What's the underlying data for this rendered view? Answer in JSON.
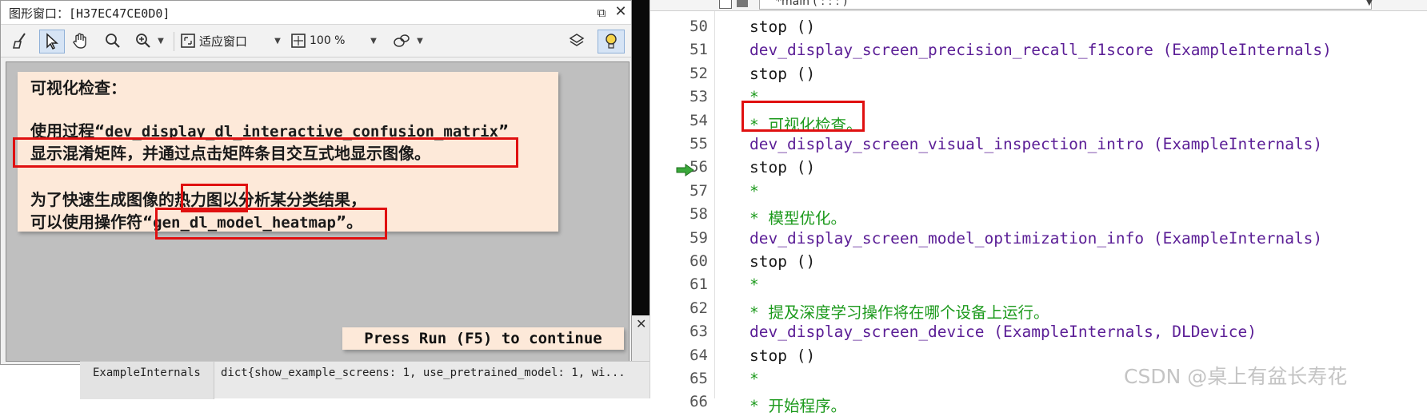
{
  "graphics_window": {
    "title": "图形窗口：[H37EC47CE0D0]",
    "toolbar": {
      "fit_label": "适应窗口",
      "zoom_label": "100 %"
    },
    "message": {
      "heading": "可视化检查：",
      "line1_a": "使用过程“",
      "line1_code": "dev_display_dl_interactive_confusion_matrix",
      "line1_b": "”",
      "line2": "显示混淆矩阵，并通过点击矩阵条目交互式地显示图像。",
      "line3": "为了快速生成图像的热力图以分析某分类结果，",
      "line4_a": "可以使用操作符“",
      "line4_code": "gen_dl_model_heatmap",
      "line4_b": "”。"
    },
    "continue_button": "Press Run (F5) to continue"
  },
  "variables": {
    "name": "ExampleInternals",
    "value": "dict{show_example_screens: 1, use_pretrained_model: 1, wi..."
  },
  "editor": {
    "procedure": "*main ( : : : )",
    "lines": [
      {
        "n": "50",
        "parts": [
          {
            "t": "stop ()",
            "c": "kw"
          }
        ]
      },
      {
        "n": "51",
        "parts": [
          {
            "t": "dev_display_screen_precision_recall_f1score",
            "c": "proc"
          },
          {
            "t": " (ExampleInternals)",
            "c": "arg"
          }
        ]
      },
      {
        "n": "52",
        "parts": [
          {
            "t": "stop ()",
            "c": "kw"
          }
        ]
      },
      {
        "n": "53",
        "parts": [
          {
            "t": "*",
            "c": "cmt"
          }
        ]
      },
      {
        "n": "54",
        "parts": [
          {
            "t": "* 可视化检查。",
            "c": "cmt"
          }
        ]
      },
      {
        "n": "55",
        "parts": [
          {
            "t": "dev_display_screen_visual_inspection_intro",
            "c": "proc"
          },
          {
            "t": " (ExampleInternals)",
            "c": "arg"
          }
        ]
      },
      {
        "n": "56",
        "parts": [
          {
            "t": "stop ()",
            "c": "kw"
          }
        ]
      },
      {
        "n": "57",
        "parts": [
          {
            "t": "*",
            "c": "cmt"
          }
        ]
      },
      {
        "n": "58",
        "parts": [
          {
            "t": "* 模型优化。",
            "c": "cmt"
          }
        ]
      },
      {
        "n": "59",
        "parts": [
          {
            "t": "dev_display_screen_model_optimization_info",
            "c": "proc"
          },
          {
            "t": " (ExampleInternals)",
            "c": "arg"
          }
        ]
      },
      {
        "n": "60",
        "parts": [
          {
            "t": "stop ()",
            "c": "kw"
          }
        ]
      },
      {
        "n": "61",
        "parts": [
          {
            "t": "*",
            "c": "cmt"
          }
        ]
      },
      {
        "n": "62",
        "parts": [
          {
            "t": "* 提及深度学习操作将在哪个设备上运行。",
            "c": "cmt"
          }
        ]
      },
      {
        "n": "63",
        "parts": [
          {
            "t": "dev_display_screen_device",
            "c": "proc"
          },
          {
            "t": " (ExampleInternals, DLDevice)",
            "c": "arg"
          }
        ]
      },
      {
        "n": "64",
        "parts": [
          {
            "t": "stop ()",
            "c": "kw"
          }
        ]
      },
      {
        "n": "65",
        "parts": [
          {
            "t": "*",
            "c": "cmt"
          }
        ]
      },
      {
        "n": "66",
        "parts": [
          {
            "t": "* 开始程序。",
            "c": "cmt"
          }
        ]
      }
    ]
  },
  "watermark": "CSDN @桌上有盆长寿花",
  "colors": {
    "procedure": "#5b1e96",
    "comment": "#1c9a1c",
    "highlight": "#e01010",
    "message_bg": "#fde9d9"
  }
}
